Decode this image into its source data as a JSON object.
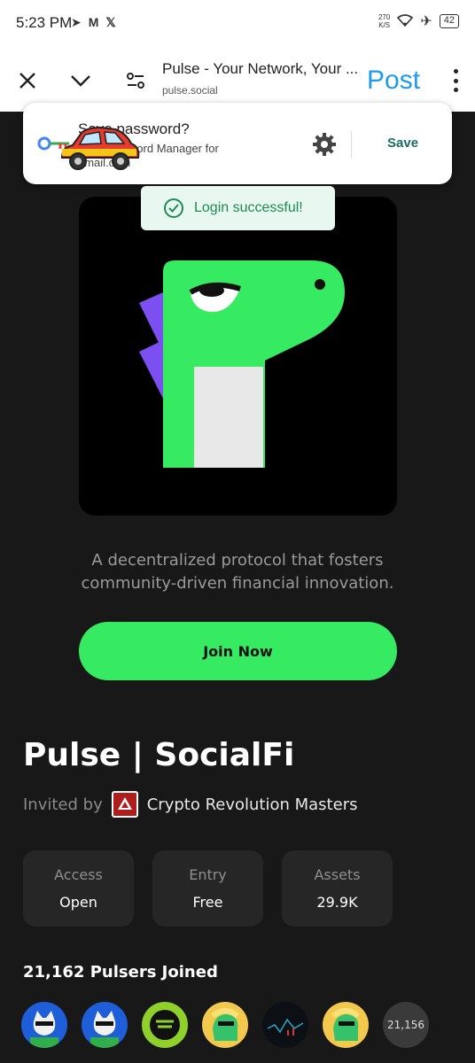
{
  "status_bar": {
    "time": "5:23 PM",
    "speed_top": "270",
    "speed_unit": "K/S",
    "battery": "42"
  },
  "browser": {
    "page_title": "Pulse - Your Network, Your ...",
    "url": "pulse.social",
    "post_label": "Post"
  },
  "save_password": {
    "title": "Save password?",
    "subtitle_line1": "Password Manager for",
    "subtitle_line2": "gmail.com",
    "save_label": "Save"
  },
  "toast": {
    "message": "Login successful!"
  },
  "hero": {
    "tagline_line1": "A decentralized protocol that fosters",
    "tagline_line2": "community-driven financial innovation."
  },
  "join_button": "Join Now",
  "community": {
    "name": "Pulse | SocialFi",
    "invited_label": "Invited by",
    "inviter": "Crypto Revolution Masters"
  },
  "stats": [
    {
      "label": "Access",
      "value": "Open"
    },
    {
      "label": "Entry",
      "value": "Free"
    },
    {
      "label": "Assets",
      "value": "29.9K"
    }
  ],
  "members": {
    "joined_text": "21,162 Pulsers Joined",
    "more_count": "21,156"
  },
  "colors": {
    "accent_green": "#36ea62",
    "post_blue": "#1d9bf0",
    "background": "#181818"
  }
}
